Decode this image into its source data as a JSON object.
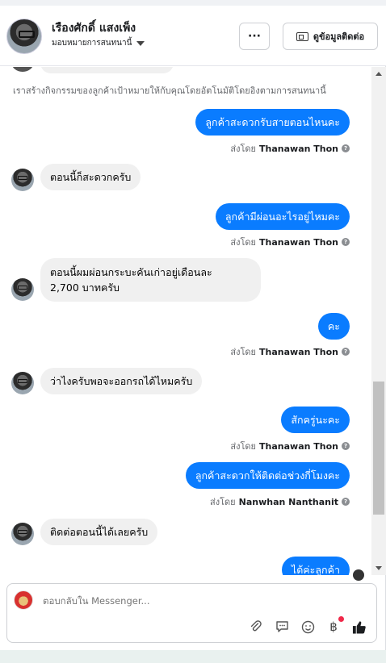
{
  "header": {
    "contact_name": "เรืองศักดิ์ แสงเพ็ง",
    "assign_label": "มอบหมายการสนทนานี้",
    "more_label": "···",
    "contact_info_label": "ดูข้อมูลติดต่อ"
  },
  "system_note": "เราสร้างกิจกรรมของลูกค้าเป้าหมายให้กับคุณโดยอัตโนมัติโดยอิงตามการสนทนานี้",
  "sent_by_prefix": "ส่งโดย",
  "messages": [
    {
      "dir": "out",
      "text": "ลูกค้าสะดวกรับสายตอนไหนคะ",
      "sender": "Thanawan Thon"
    },
    {
      "dir": "in",
      "text": "ตอนนี้ก็สะดวกครับ"
    },
    {
      "dir": "out",
      "text": "ลูกค้ามีผ่อนอะไรอยู่ไหมคะ",
      "sender": "Thanawan Thon"
    },
    {
      "dir": "in",
      "line1": "ตอนนี้ผมผ่อนกระบะคันเก่าอยู่เดือนละ",
      "line2": "2,700 บาทครับ"
    },
    {
      "dir": "out",
      "text": "คะ",
      "sender": "Thanawan Thon"
    },
    {
      "dir": "in",
      "text": "ว่าไงครับพอจะออกรถได้ไหมครับ"
    },
    {
      "dir": "out",
      "text": "สักครู่นะคะ",
      "sender": "Thanawan Thon"
    },
    {
      "dir": "out",
      "text": "ลูกค้าสะดวกให้ติดต่อช่วงกี่โมงคะ",
      "sender": "Nanwhan Nanthanit"
    },
    {
      "dir": "in",
      "text": "ติดต่อตอนนี้ได้เลยครับ"
    },
    {
      "dir": "out",
      "text": "ได้ค่ะลูกค้า"
    }
  ],
  "composer": {
    "placeholder": "ตอบกลับใน Messenger..."
  },
  "icons": {
    "attach": "paperclip-icon",
    "saved_replies": "chat-bubble-icon",
    "emoji": "smiley-icon",
    "payment": "baht-icon",
    "like": "thumbs-up-icon"
  },
  "colors": {
    "outgoing_bubble": "#0a7cff",
    "incoming_bubble": "#f0f0f0"
  }
}
